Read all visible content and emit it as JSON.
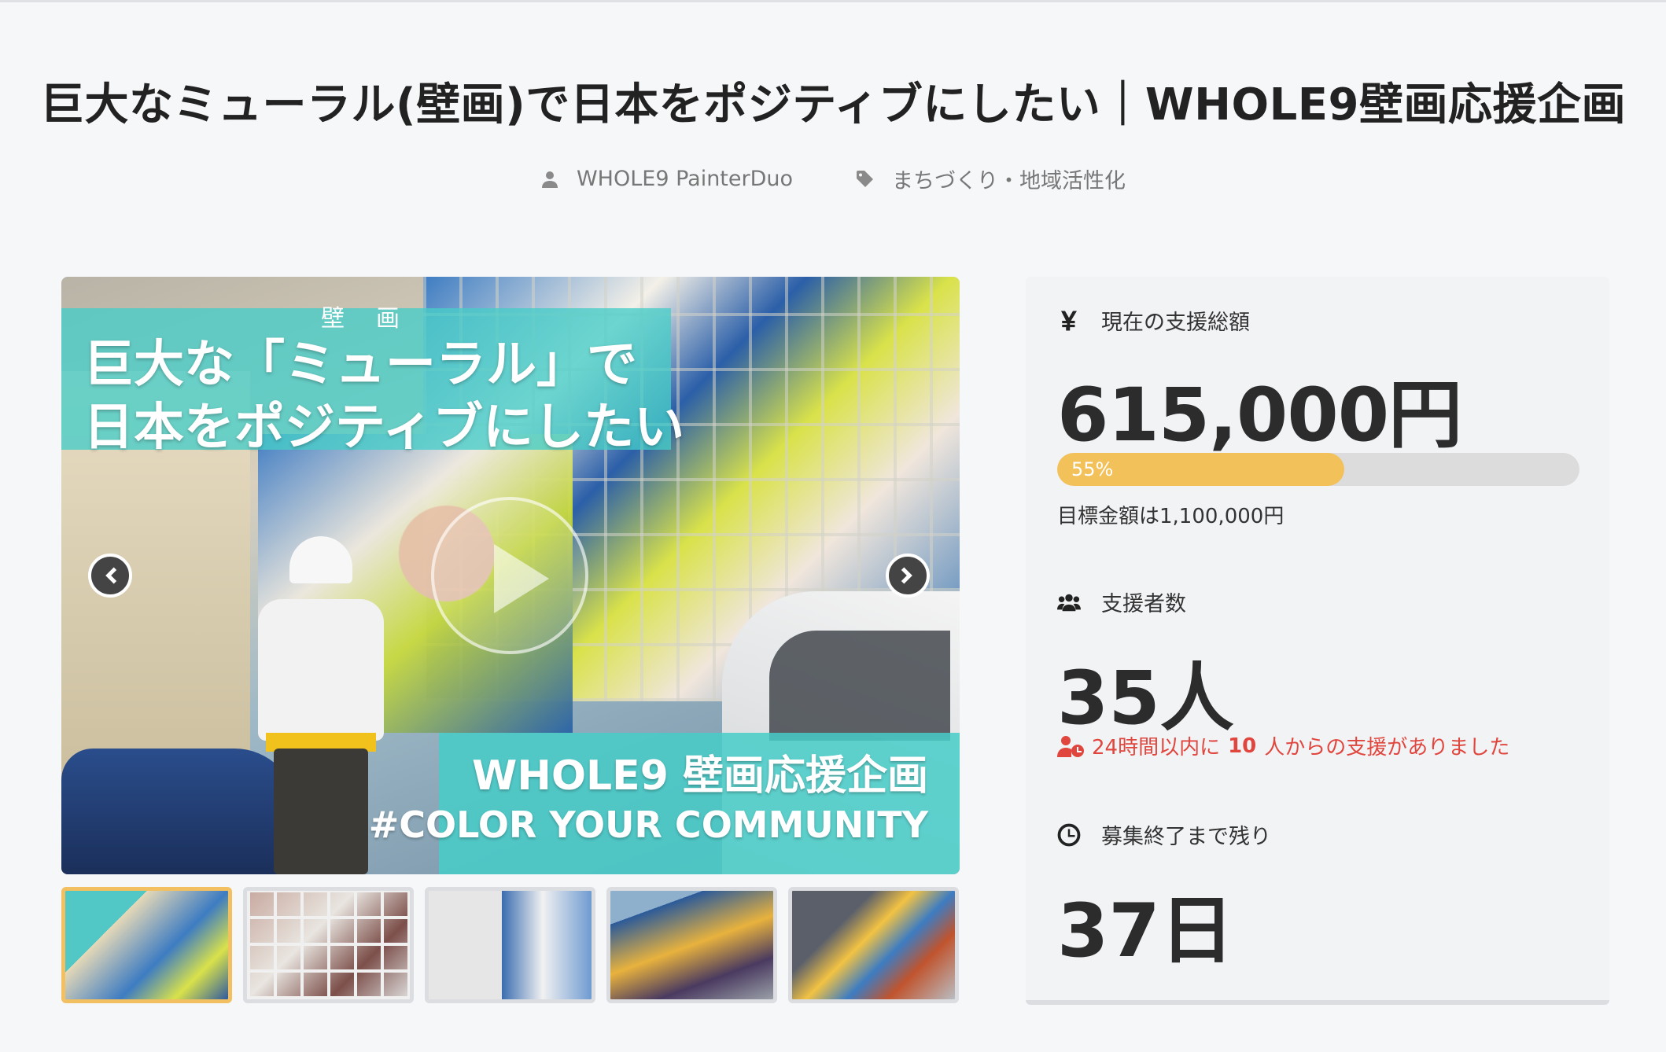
{
  "project": {
    "title": "巨大なミューラル(壁画)で日本をポジティブにしたい｜WHOLE9壁画応援企画",
    "author": "WHOLE9 PainterDuo",
    "category": "まちづくり・地域活性化",
    "author_icon": "user-icon",
    "category_icon": "tag-icon"
  },
  "gallery": {
    "image_text": {
      "ruby": "壁画",
      "line1": "巨大な「ミューラル」で",
      "line2": "日本をポジティブにしたい",
      "sub1": "WHOLE9 壁画応援企画",
      "sub2": "#COLOR YOUR COMMUNITY"
    },
    "thumbnails": [
      "thumb-1",
      "thumb-2",
      "thumb-3",
      "thumb-4",
      "thumb-5"
    ],
    "active_index": 0
  },
  "stats": {
    "amount_label": "現在の支援総額",
    "amount_value": "615,000円",
    "progress_percent": 55,
    "progress_label": "55%",
    "goal_text": "目標金額は1,100,000円",
    "backers_label": "支援者数",
    "backers_value": "35人",
    "recent_prefix": "24時間以内に",
    "recent_count": "10",
    "recent_suffix": "人からの支援がありました",
    "remaining_label": "募集終了まで残り",
    "remaining_value": "37日"
  },
  "colors": {
    "progress_fill": "#f2c15a",
    "progress_track": "#dcdcdc",
    "alert": "#e0463d",
    "accent_teal": "#46cdc8",
    "active_thumb_border": "#f2c061"
  }
}
